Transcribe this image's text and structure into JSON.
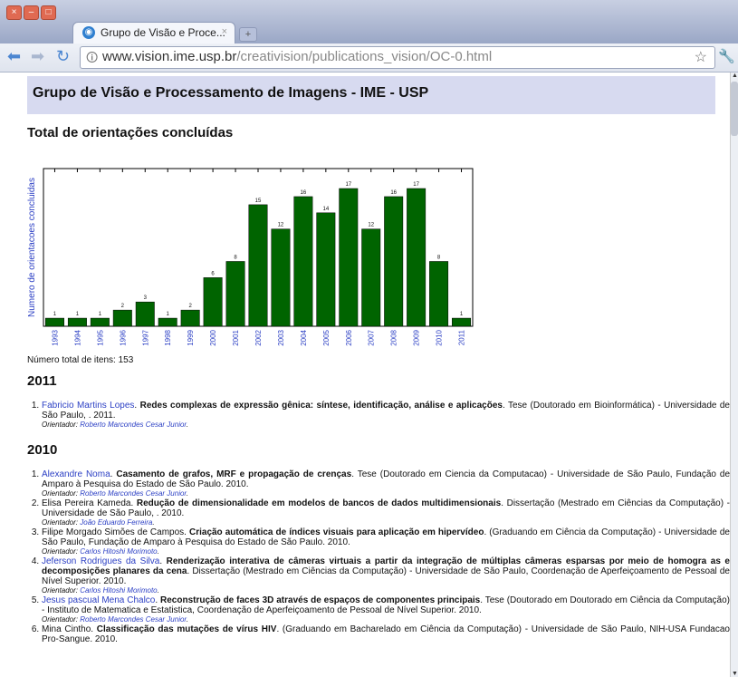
{
  "window": {
    "controls": [
      "×",
      "–",
      "□"
    ],
    "tab_title": "Grupo de Visão e Proce...",
    "tab_close": "×",
    "new_tab": "+"
  },
  "toolbar": {
    "url_host": "www.vision.ime.usp.br",
    "url_path": "/creativision/publications_vision/OC-0.html"
  },
  "page": {
    "banner_title": "Grupo de Visão e Processamento de Imagens - IME - USP",
    "section_title": "Total de orientações concluídas",
    "total_label": "Número total de itens: 153"
  },
  "chart_data": {
    "type": "bar",
    "ylabel": "Numero de orientacoes concluidas",
    "xlabel": "",
    "categories": [
      "1993",
      "1994",
      "1995",
      "1996",
      "1997",
      "1998",
      "1999",
      "2000",
      "2001",
      "2002",
      "2003",
      "2004",
      "2005",
      "2006",
      "2007",
      "2008",
      "2009",
      "2010",
      "2011"
    ],
    "values": [
      1,
      1,
      1,
      2,
      3,
      1,
      2,
      6,
      8,
      15,
      12,
      16,
      14,
      17,
      12,
      16,
      17,
      8,
      1
    ],
    "ylim": [
      0,
      17
    ],
    "bar_color": "#006400",
    "tick_label_color": "#2b3fc4"
  },
  "sections": [
    {
      "year": "2011",
      "items": [
        {
          "author": "Fabricio Martins Lopes",
          "title": "Redes complexas de expressão gênica: síntese, identificação, análise e aplicações",
          "details": ". Tese (Doutorado em Bioinformática) - Universidade de São Paulo, . 2011.",
          "advisor_label": "Orientador:",
          "advisor": "Roberto Marcondes Cesar Junior",
          "author_link": true
        }
      ]
    },
    {
      "year": "2010",
      "items": [
        {
          "author": "Alexandre Noma",
          "title": "Casamento de grafos, MRF e propagação de crenças",
          "details": ". Tese (Doutorado em Ciencia da Computacao) - Universidade de São Paulo, Fundação de Amparo à Pesquisa do Estado de São Paulo. 2010.",
          "advisor_label": "Orientador:",
          "advisor": "Roberto Marcondes Cesar Junior",
          "author_link": true
        },
        {
          "author": "Elisa Pereira Kameda",
          "title": "Redução de dimensionalidade em modelos de bancos de dados multidimensionais",
          "details": ". Dissertação (Mestrado em Ciências da Computação) - Universidade de São Paulo, . 2010.",
          "advisor_label": "Orientador:",
          "advisor": "João Eduardo Ferreira",
          "author_link": false
        },
        {
          "author": "Filipe Morgado Simões de Campos",
          "title": "Criação automática de índices visuais para aplicação em hipervídeo",
          "details": ". (Graduando em Ciência da Computação) - Universidade de São Paulo, Fundação de Amparo à Pesquisa do Estado de São Paulo. 2010.",
          "advisor_label": "Orientador:",
          "advisor": "Carlos Hitoshi Morimoto",
          "author_link": false
        },
        {
          "author": "Jeferson Rodrigues da Silva",
          "title": "Renderização interativa de câmeras virtuais a partir da integração de múltiplas câmeras esparsas por meio de homogra as e decomposições planares da cena",
          "details": ". Dissertação (Mestrado em Ciências da Computação) - Universidade de São Paulo, Coordenação de Aperfeiçoamento de Pessoal de Nível Superior. 2010.",
          "advisor_label": "Orientador:",
          "advisor": "Carlos Hitoshi Morimoto",
          "author_link": true
        },
        {
          "author": "Jesus pascual Mena Chalco",
          "title": "Reconstrução de faces 3D através de espaços de componentes principais",
          "details": ". Tese (Doutorado em Doutorado em Ciência da Computação) - Instituto de Matematica e Estatistica, Coordenação de Aperfeiçoamento de Pessoal de Nível Superior. 2010.",
          "advisor_label": "Orientador:",
          "advisor": "Roberto Marcondes Cesar Junior",
          "author_link": true
        },
        {
          "author": "Mina Cintho",
          "title": "Classificação das mutações de vírus HIV",
          "details": ". (Graduando em Bacharelado em Ciência da Computação) - Universidade de São Paulo, NIH-USA Fundacao Pro-Sangue. 2010.",
          "advisor_label": "",
          "advisor": "",
          "author_link": false
        }
      ]
    }
  ]
}
